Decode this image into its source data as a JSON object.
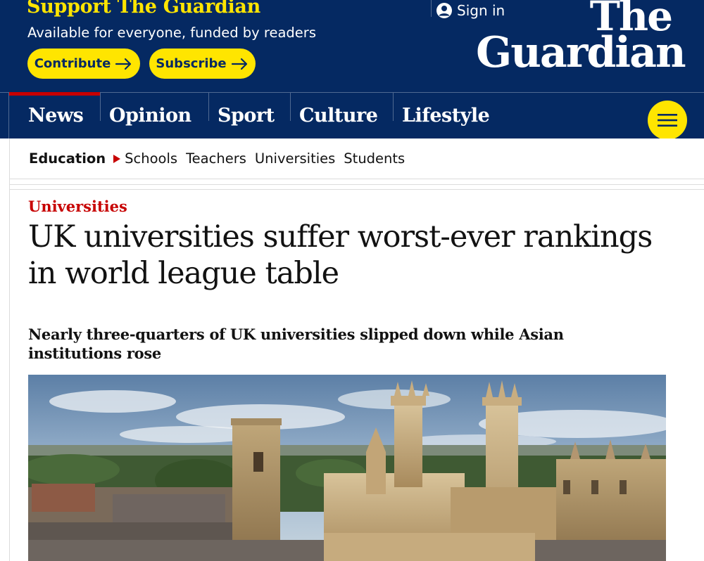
{
  "header": {
    "support_title": "Support The Guardian",
    "support_subtitle": "Available for everyone, funded by readers",
    "contribute_label": "Contribute",
    "subscribe_label": "Subscribe",
    "sign_in_label": "Sign in",
    "logo_line1": "The",
    "logo_line2": "Guardian"
  },
  "nav": {
    "items": [
      {
        "label": "News",
        "active": true
      },
      {
        "label": "Opinion"
      },
      {
        "label": "Sport"
      },
      {
        "label": "Culture"
      },
      {
        "label": "Lifestyle"
      }
    ],
    "menu_icon": "hamburger-icon"
  },
  "subnav": {
    "section": "Education",
    "links": [
      "Schools",
      "Teachers",
      "Universities",
      "Students"
    ]
  },
  "article": {
    "kicker": "Universities",
    "headline": "UK universities suffer worst-ever rankings in world league table",
    "standfirst": "Nearly three-quarters of UK universities slipped down while Asian institutions rose"
  },
  "colors": {
    "brand_blue": "#052962",
    "accent_yellow": "#ffe500",
    "news_red": "#c70000"
  }
}
